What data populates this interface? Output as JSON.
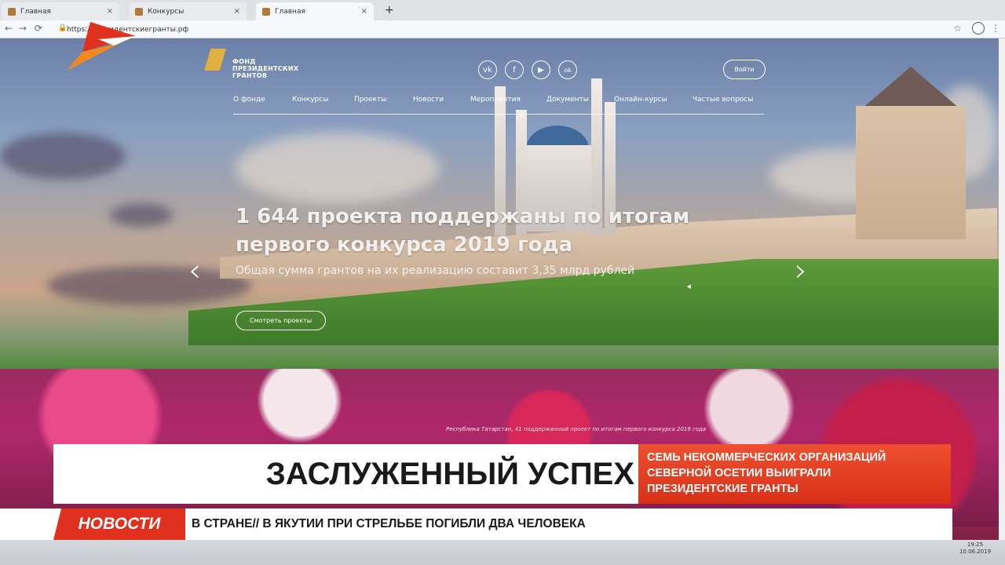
{
  "browser": {
    "tabs": [
      {
        "label": "Главная"
      },
      {
        "label": "Конкурсы"
      },
      {
        "label": "Главная"
      }
    ],
    "new_tab": "+",
    "close_glyph": "×",
    "url": "https://президентскиегранты.рф",
    "back_icon": "←",
    "forward_icon": "→",
    "reload_icon": "⟳",
    "star_icon": "☆",
    "menu_icon": "⋮"
  },
  "site": {
    "logo_text": [
      "ФОНД",
      "ПРЕЗИДЕНТСКИХ",
      "ГРАНТОВ"
    ],
    "socials": [
      "vk",
      "f",
      "▶",
      "ok"
    ],
    "login": "Войти",
    "menu": [
      "О фонде",
      "Конкурсы",
      "Проекты",
      "Новости",
      "Мероприятия",
      "Документы",
      "Онлайн-курсы",
      "Частые вопросы"
    ],
    "headline_1": "1 644 проекта поддержаны по итогам",
    "headline_2": "первого конкурса 2019 года",
    "subhead": "Общая сумма грантов на их реализацию составит 3,35 млрд рублей",
    "view_button": "Смотреть проекты",
    "caption": "Республика Татарстан, 41 поддержанный проект по итогам первого конкурса 2019 года",
    "prev_arrow": "‹",
    "next_arrow": "›"
  },
  "broadcast": {
    "title": "ЗАСЛУЖЕННЫЙ УСПЕХ",
    "subtitle_1": "СЕМЬ НЕКОММЕРЧЕСКИХ ОРГАНИЗАЦИЙ",
    "subtitle_2": "СЕВЕРНОЙ ОСЕТИИ ВЫИГРАЛИ",
    "subtitle_3": "ПРЕЗИДЕНТСКИЕ ГРАНТЫ",
    "news_label": "НОВОСТИ",
    "ticker": "В СТРАНЕ// В ЯКУТИИ ПРИ СТРЕЛЬБЕ ПОГИБЛИ ДВА ЧЕЛОВЕКА",
    "colors": {
      "accent": "#e0301e",
      "banner_bg": "#ffffff"
    }
  },
  "taskbar": {
    "time": "19:25",
    "date": "10.06.2019"
  }
}
